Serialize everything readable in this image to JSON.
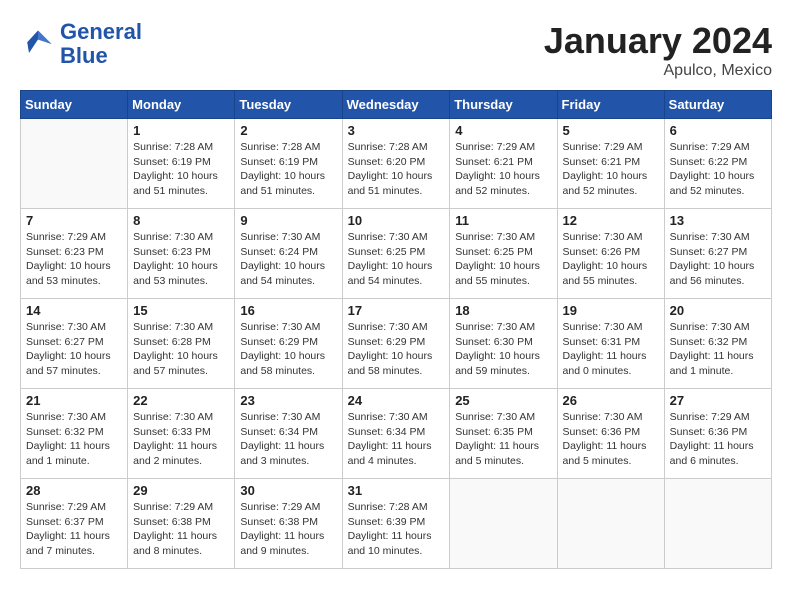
{
  "header": {
    "logo_line1": "General",
    "logo_line2": "Blue",
    "title": "January 2024",
    "subtitle": "Apulco, Mexico"
  },
  "weekdays": [
    "Sunday",
    "Monday",
    "Tuesday",
    "Wednesday",
    "Thursday",
    "Friday",
    "Saturday"
  ],
  "weeks": [
    [
      {
        "day": "",
        "empty": true
      },
      {
        "day": "1",
        "sunrise": "7:28 AM",
        "sunset": "6:19 PM",
        "daylight": "10 hours and 51 minutes."
      },
      {
        "day": "2",
        "sunrise": "7:28 AM",
        "sunset": "6:19 PM",
        "daylight": "10 hours and 51 minutes."
      },
      {
        "day": "3",
        "sunrise": "7:28 AM",
        "sunset": "6:20 PM",
        "daylight": "10 hours and 51 minutes."
      },
      {
        "day": "4",
        "sunrise": "7:29 AM",
        "sunset": "6:21 PM",
        "daylight": "10 hours and 52 minutes."
      },
      {
        "day": "5",
        "sunrise": "7:29 AM",
        "sunset": "6:21 PM",
        "daylight": "10 hours and 52 minutes."
      },
      {
        "day": "6",
        "sunrise": "7:29 AM",
        "sunset": "6:22 PM",
        "daylight": "10 hours and 52 minutes."
      }
    ],
    [
      {
        "day": "7",
        "sunrise": "7:29 AM",
        "sunset": "6:23 PM",
        "daylight": "10 hours and 53 minutes."
      },
      {
        "day": "8",
        "sunrise": "7:30 AM",
        "sunset": "6:23 PM",
        "daylight": "10 hours and 53 minutes."
      },
      {
        "day": "9",
        "sunrise": "7:30 AM",
        "sunset": "6:24 PM",
        "daylight": "10 hours and 54 minutes."
      },
      {
        "day": "10",
        "sunrise": "7:30 AM",
        "sunset": "6:25 PM",
        "daylight": "10 hours and 54 minutes."
      },
      {
        "day": "11",
        "sunrise": "7:30 AM",
        "sunset": "6:25 PM",
        "daylight": "10 hours and 55 minutes."
      },
      {
        "day": "12",
        "sunrise": "7:30 AM",
        "sunset": "6:26 PM",
        "daylight": "10 hours and 55 minutes."
      },
      {
        "day": "13",
        "sunrise": "7:30 AM",
        "sunset": "6:27 PM",
        "daylight": "10 hours and 56 minutes."
      }
    ],
    [
      {
        "day": "14",
        "sunrise": "7:30 AM",
        "sunset": "6:27 PM",
        "daylight": "10 hours and 57 minutes."
      },
      {
        "day": "15",
        "sunrise": "7:30 AM",
        "sunset": "6:28 PM",
        "daylight": "10 hours and 57 minutes."
      },
      {
        "day": "16",
        "sunrise": "7:30 AM",
        "sunset": "6:29 PM",
        "daylight": "10 hours and 58 minutes."
      },
      {
        "day": "17",
        "sunrise": "7:30 AM",
        "sunset": "6:29 PM",
        "daylight": "10 hours and 58 minutes."
      },
      {
        "day": "18",
        "sunrise": "7:30 AM",
        "sunset": "6:30 PM",
        "daylight": "10 hours and 59 minutes."
      },
      {
        "day": "19",
        "sunrise": "7:30 AM",
        "sunset": "6:31 PM",
        "daylight": "11 hours and 0 minutes."
      },
      {
        "day": "20",
        "sunrise": "7:30 AM",
        "sunset": "6:32 PM",
        "daylight": "11 hours and 1 minute."
      }
    ],
    [
      {
        "day": "21",
        "sunrise": "7:30 AM",
        "sunset": "6:32 PM",
        "daylight": "11 hours and 1 minute."
      },
      {
        "day": "22",
        "sunrise": "7:30 AM",
        "sunset": "6:33 PM",
        "daylight": "11 hours and 2 minutes."
      },
      {
        "day": "23",
        "sunrise": "7:30 AM",
        "sunset": "6:34 PM",
        "daylight": "11 hours and 3 minutes."
      },
      {
        "day": "24",
        "sunrise": "7:30 AM",
        "sunset": "6:34 PM",
        "daylight": "11 hours and 4 minutes."
      },
      {
        "day": "25",
        "sunrise": "7:30 AM",
        "sunset": "6:35 PM",
        "daylight": "11 hours and 5 minutes."
      },
      {
        "day": "26",
        "sunrise": "7:30 AM",
        "sunset": "6:36 PM",
        "daylight": "11 hours and 5 minutes."
      },
      {
        "day": "27",
        "sunrise": "7:29 AM",
        "sunset": "6:36 PM",
        "daylight": "11 hours and 6 minutes."
      }
    ],
    [
      {
        "day": "28",
        "sunrise": "7:29 AM",
        "sunset": "6:37 PM",
        "daylight": "11 hours and 7 minutes."
      },
      {
        "day": "29",
        "sunrise": "7:29 AM",
        "sunset": "6:38 PM",
        "daylight": "11 hours and 8 minutes."
      },
      {
        "day": "30",
        "sunrise": "7:29 AM",
        "sunset": "6:38 PM",
        "daylight": "11 hours and 9 minutes."
      },
      {
        "day": "31",
        "sunrise": "7:28 AM",
        "sunset": "6:39 PM",
        "daylight": "11 hours and 10 minutes."
      },
      {
        "day": "",
        "empty": true
      },
      {
        "day": "",
        "empty": true
      },
      {
        "day": "",
        "empty": true
      }
    ]
  ]
}
